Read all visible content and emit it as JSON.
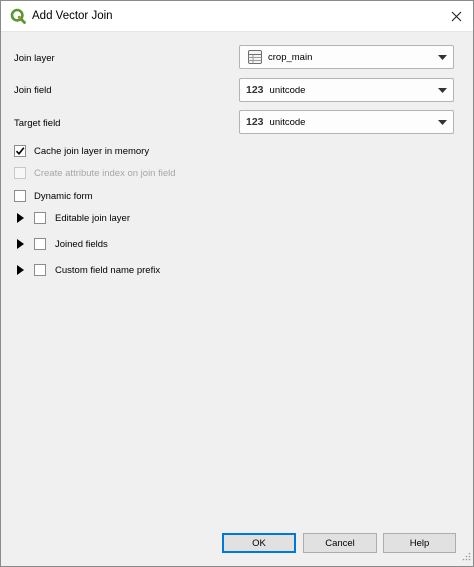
{
  "window": {
    "title": "Add Vector Join",
    "app_icon": "qgis-logo-icon",
    "close_icon": "close-icon"
  },
  "colors": {
    "qgis_green": "#589632",
    "qgis_yellow": "#ee7913",
    "default_button_border": "#0078d7",
    "dialog_background": "#f0f0f0"
  },
  "form": {
    "join_layer": {
      "label": "Join layer",
      "value": "crop_main",
      "icon": "table-layer-icon"
    },
    "join_field": {
      "label": "Join field",
      "value": "unitcode",
      "type_icon": "123"
    },
    "target_field": {
      "label": "Target field",
      "value": "unitcode",
      "type_icon": "123"
    }
  },
  "options": {
    "cache": {
      "label": "Cache join layer in memory",
      "checked": true,
      "enabled": true
    },
    "attr_index": {
      "label": "Create attribute index on join field",
      "checked": false,
      "enabled": false
    },
    "dynamic_form": {
      "label": "Dynamic form",
      "checked": false,
      "enabled": true
    }
  },
  "groups": {
    "editable": {
      "label": "Editable join layer",
      "expanded": false,
      "checked": false
    },
    "joined_fields": {
      "label": "Joined fields",
      "expanded": false,
      "checked": false
    },
    "prefix": {
      "label": "Custom field name prefix",
      "expanded": false,
      "checked": false
    }
  },
  "buttons": {
    "ok": "OK",
    "cancel": "Cancel",
    "help": "Help"
  }
}
